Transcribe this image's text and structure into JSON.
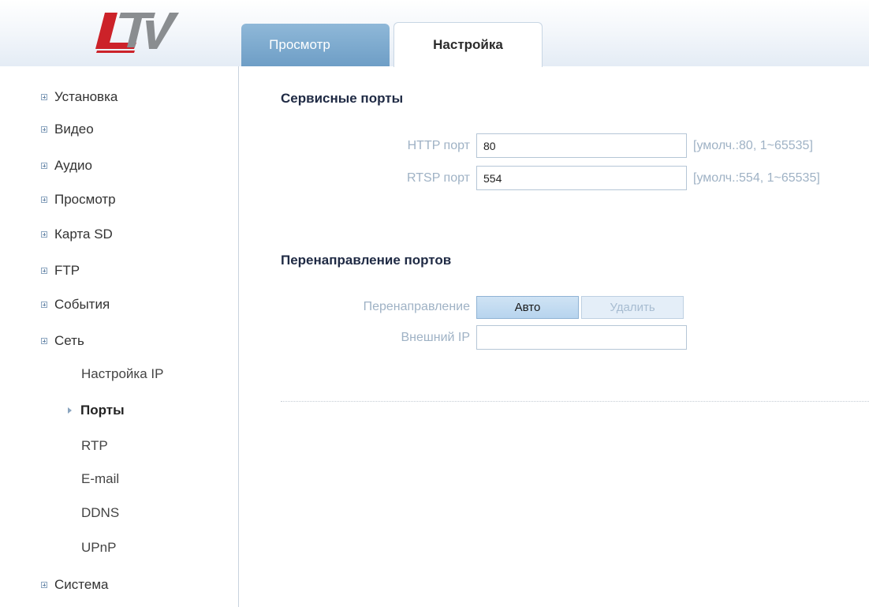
{
  "logo": {
    "text": "LTV"
  },
  "tabs": [
    {
      "label": "Просмотр",
      "active": false
    },
    {
      "label": "Настройка",
      "active": true
    }
  ],
  "sidebar": {
    "items": [
      {
        "label": "Установка"
      },
      {
        "label": "Видео"
      },
      {
        "label": "Аудио"
      },
      {
        "label": "Просмотр"
      },
      {
        "label": "Карта SD"
      },
      {
        "label": "FTP"
      },
      {
        "label": "События"
      },
      {
        "label": "Сеть"
      }
    ],
    "subitems": [
      {
        "label": "Настройка IP"
      },
      {
        "label": "Порты",
        "active": true
      },
      {
        "label": "RTP"
      },
      {
        "label": "E-mail"
      },
      {
        "label": "DDNS"
      },
      {
        "label": "UPnP"
      }
    ],
    "last_item": {
      "label": "Система"
    }
  },
  "service_ports": {
    "title": "Сервисные порты",
    "http": {
      "label": "HTTP порт",
      "value": "80",
      "hint": "[умолч.:80, 1~65535]"
    },
    "rtsp": {
      "label": "RTSP порт",
      "value": "554",
      "hint": "[умолч.:554, 1~65535]"
    }
  },
  "port_forwarding": {
    "title": "Перенаправление портов",
    "forward_label": "Перенаправление",
    "auto_button": "Авто",
    "delete_button": "Удалить",
    "external_ip_label": "Внешний IP",
    "external_ip_value": ""
  },
  "colors": {
    "tab_inactive": "#7aa7cc",
    "label_text": "#9fb2c5",
    "title_text": "#1f2a44",
    "logo_red": "#cc2229",
    "logo_gray": "#8a8d90"
  }
}
